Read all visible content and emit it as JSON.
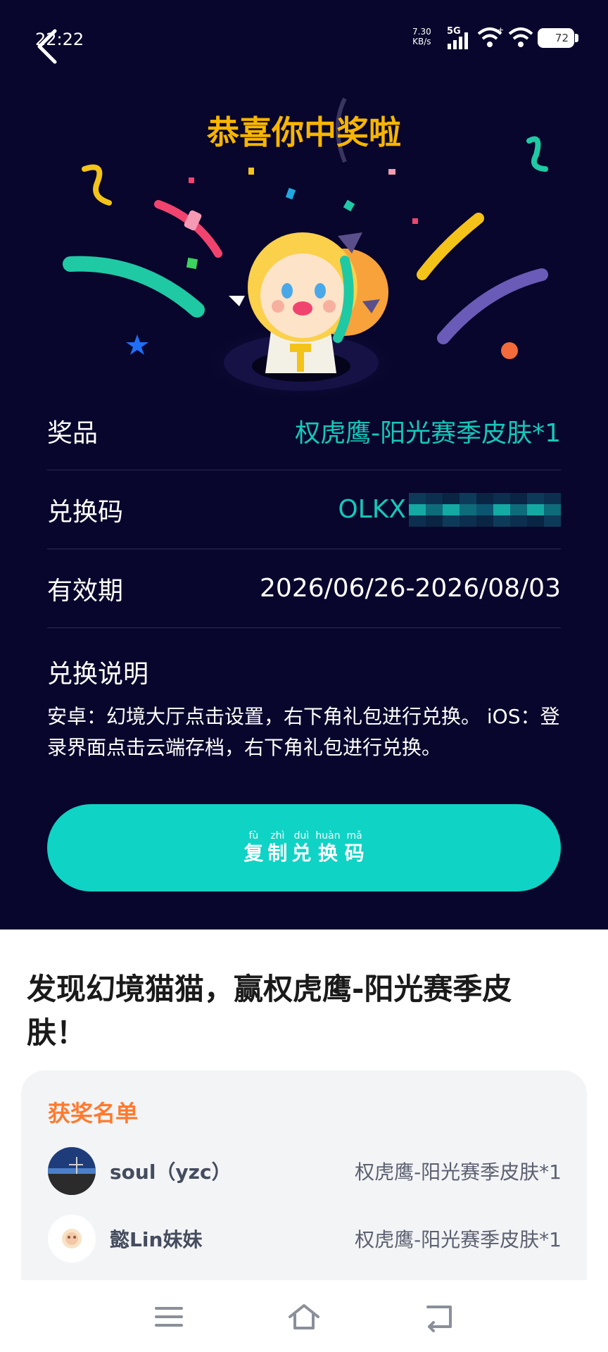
{
  "status_bar": {
    "time": "22:22",
    "net_speed": "7.30",
    "net_unit": "KB/s",
    "network": "5G",
    "battery": "72"
  },
  "header": {
    "congrats": "恭喜你中奖啦"
  },
  "prize_info": {
    "prize_label": "奖品",
    "prize_value": "权虎鹰-阳光赛季皮肤*1",
    "code_label": "兑换码",
    "code_value": "OLKX",
    "validity_label": "有效期",
    "validity_value": "2026/06/26-2026/08/03",
    "note_title": "兑换说明",
    "note_body": "安卓：幻境大厅点击设置，右下角礼包进行兑换。 iOS：登录界面点击云端存档，右下角礼包进行兑换。"
  },
  "copy_button": {
    "chars": [
      {
        "py": "fù",
        "hz": "复"
      },
      {
        "py": "zhì",
        "hz": "制"
      },
      {
        "py": "duì",
        "hz": "兑"
      },
      {
        "py": "huàn",
        "hz": "换"
      },
      {
        "py": "mǎ",
        "hz": "码"
      }
    ]
  },
  "promo": {
    "title": "发现幻境猫猫，赢权虎鹰-阳光赛季皮肤！"
  },
  "winners": {
    "title": "获奖名单",
    "list": [
      {
        "name": "soul（yzc）",
        "prize": "权虎鹰-阳光赛季皮肤*1"
      },
      {
        "name": "懿Lin妹妹",
        "prize": "权虎鹰-阳光赛季皮肤*1"
      }
    ]
  },
  "colors": {
    "bg_dark": "#08062c",
    "accent_teal": "#0fd3c4",
    "title_gold": "#f7b500",
    "winners_orange": "#ff7a2e"
  },
  "icons": [
    "back-icon",
    "signal-icon",
    "wifi-icon",
    "battery-icon",
    "menu-icon",
    "home-icon",
    "back-nav-icon"
  ]
}
